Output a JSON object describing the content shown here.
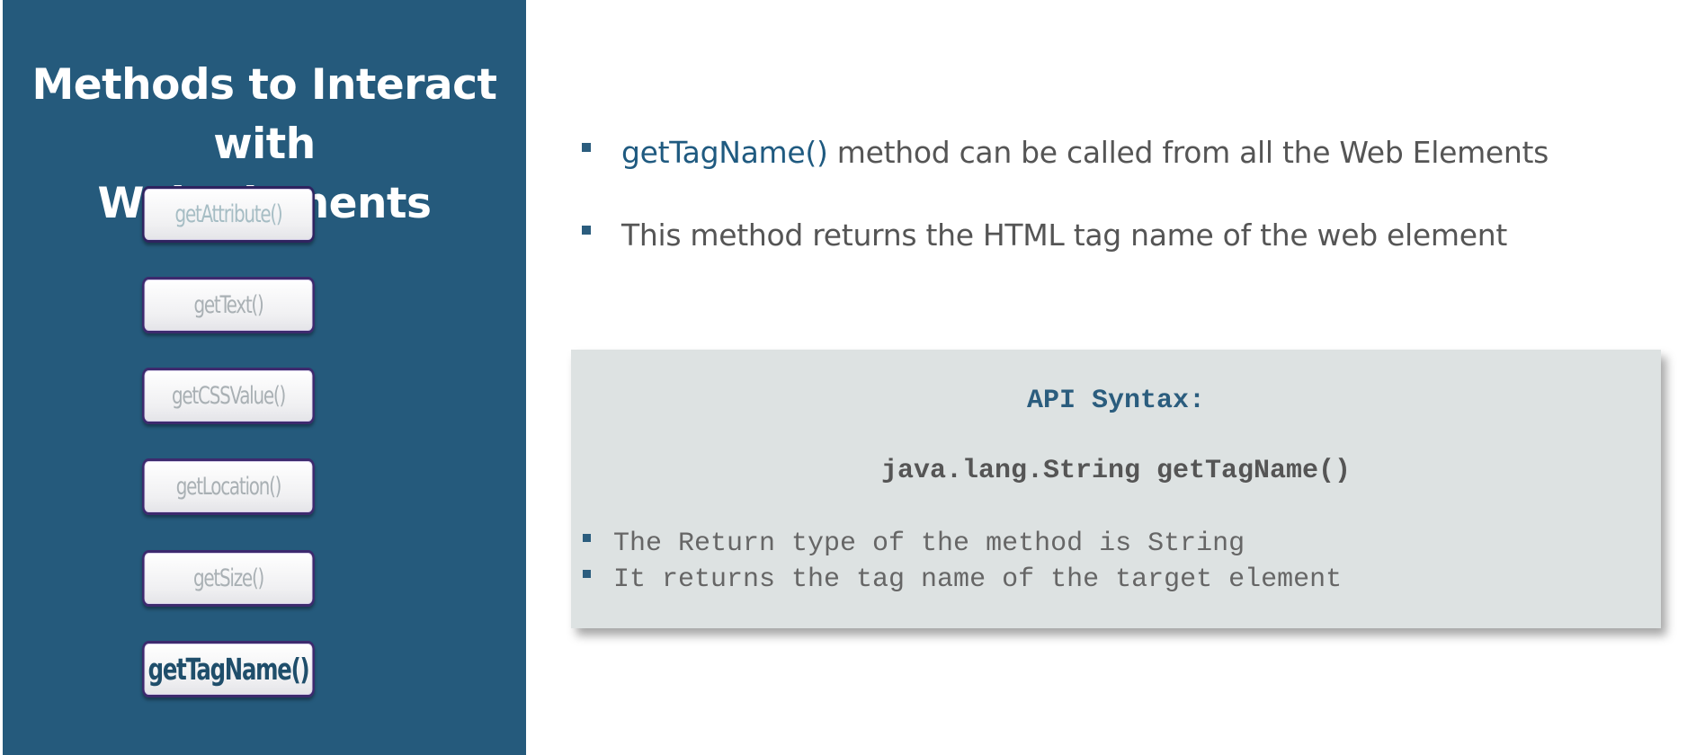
{
  "sidebar": {
    "title_line1": "Methods to Interact with",
    "title_line2": "Web Elements",
    "methods": [
      {
        "label": "getAttribute()"
      },
      {
        "label": "getText()"
      },
      {
        "label": "getCSSValue()"
      },
      {
        "label": "getLocation()"
      },
      {
        "label": "getSize()"
      },
      {
        "label": "getTagName()"
      }
    ],
    "active_method": "getTagName()"
  },
  "content": {
    "bullet1": {
      "method": "getTagName()",
      "text": " method can be called from all the Web Elements"
    },
    "bullet2": {
      "text": "This method returns the HTML tag name of the web element"
    },
    "syntax": {
      "heading": "API Syntax:",
      "code": "java.lang.String getTagName()",
      "notes": [
        "The Return type of the method is String",
        "It returns the tag name of the target element"
      ]
    }
  },
  "colors": {
    "sidebar_bg": "#255a7c",
    "accent": "#1f5a80",
    "box_bg": "#dde2e2"
  }
}
